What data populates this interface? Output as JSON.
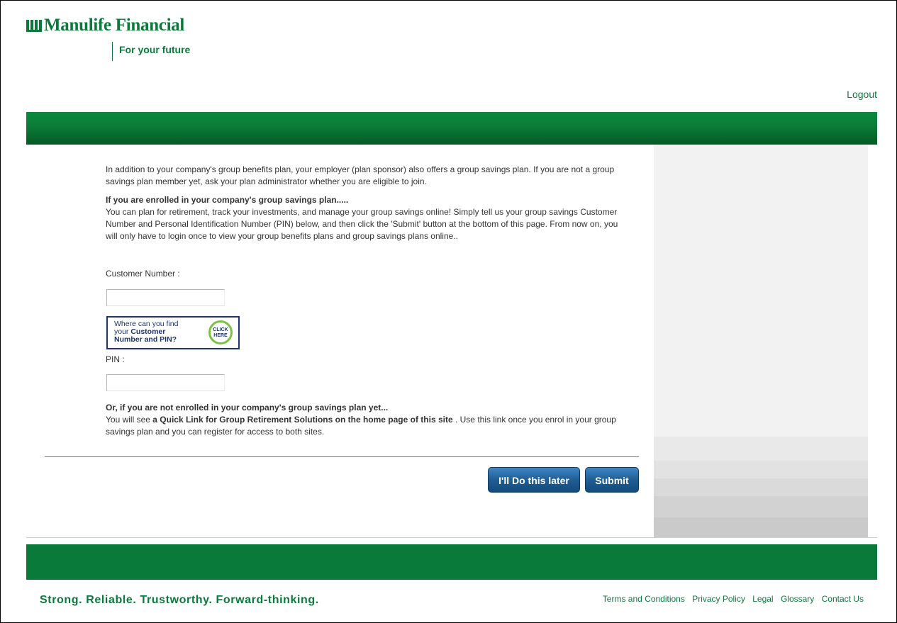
{
  "brand": {
    "name": "Manulife Financial",
    "tagline": "For your future"
  },
  "header": {
    "logout_label": "Logout"
  },
  "content": {
    "intro": "In addition to your company's group benefits plan, your employer (plan sponsor) also offers a group savings plan. If you are not a group savings plan member yet, ask your plan administrator whether you are eligible to join.",
    "enrolled_heading": "If you are enrolled in your company's group savings plan.....",
    "enrolled_text": "You can plan for retirement, track your investments, and manage your group savings online! Simply tell us your group savings Customer Number and Personal Identification Number (PIN) below, and then click the 'Submit' button at the bottom of this page. From now on, you will only have to login once to view your group benefits plans and group savings plans online..",
    "customer_number_label": "Customer Number :",
    "customer_number_value": "",
    "pin_label": "PIN :",
    "pin_value": "",
    "finder": {
      "line1": "Where can you find",
      "line2_prefix": "your ",
      "line2_bold": "Customer",
      "line3_bold": "Number and PIN?",
      "badge_line1": "CLICK",
      "badge_line2": "HERE"
    },
    "not_enrolled_heading": "Or, if you are not enrolled in your company's group savings plan yet...",
    "not_enrolled_prefix": "You will see ",
    "not_enrolled_bold": "a Quick Link for Group Retirement Solutions on the home page of this site",
    "not_enrolled_suffix": " . Use this link once you enrol in your group savings plan and you can register for access to both sites."
  },
  "actions": {
    "later_label": "I'll Do this later",
    "submit_label": "Submit"
  },
  "footer": {
    "slogan": "Strong. Reliable. Trustworthy. Forward-thinking.",
    "links": [
      "Terms and Conditions",
      "Privacy Policy",
      "Legal",
      "Glossary",
      "Contact Us"
    ]
  },
  "colors": {
    "brand_green": "#0a7a3a",
    "button_blue": "#1f5e95",
    "finder_navy": "#1f3470",
    "badge_green": "#7cc242"
  }
}
